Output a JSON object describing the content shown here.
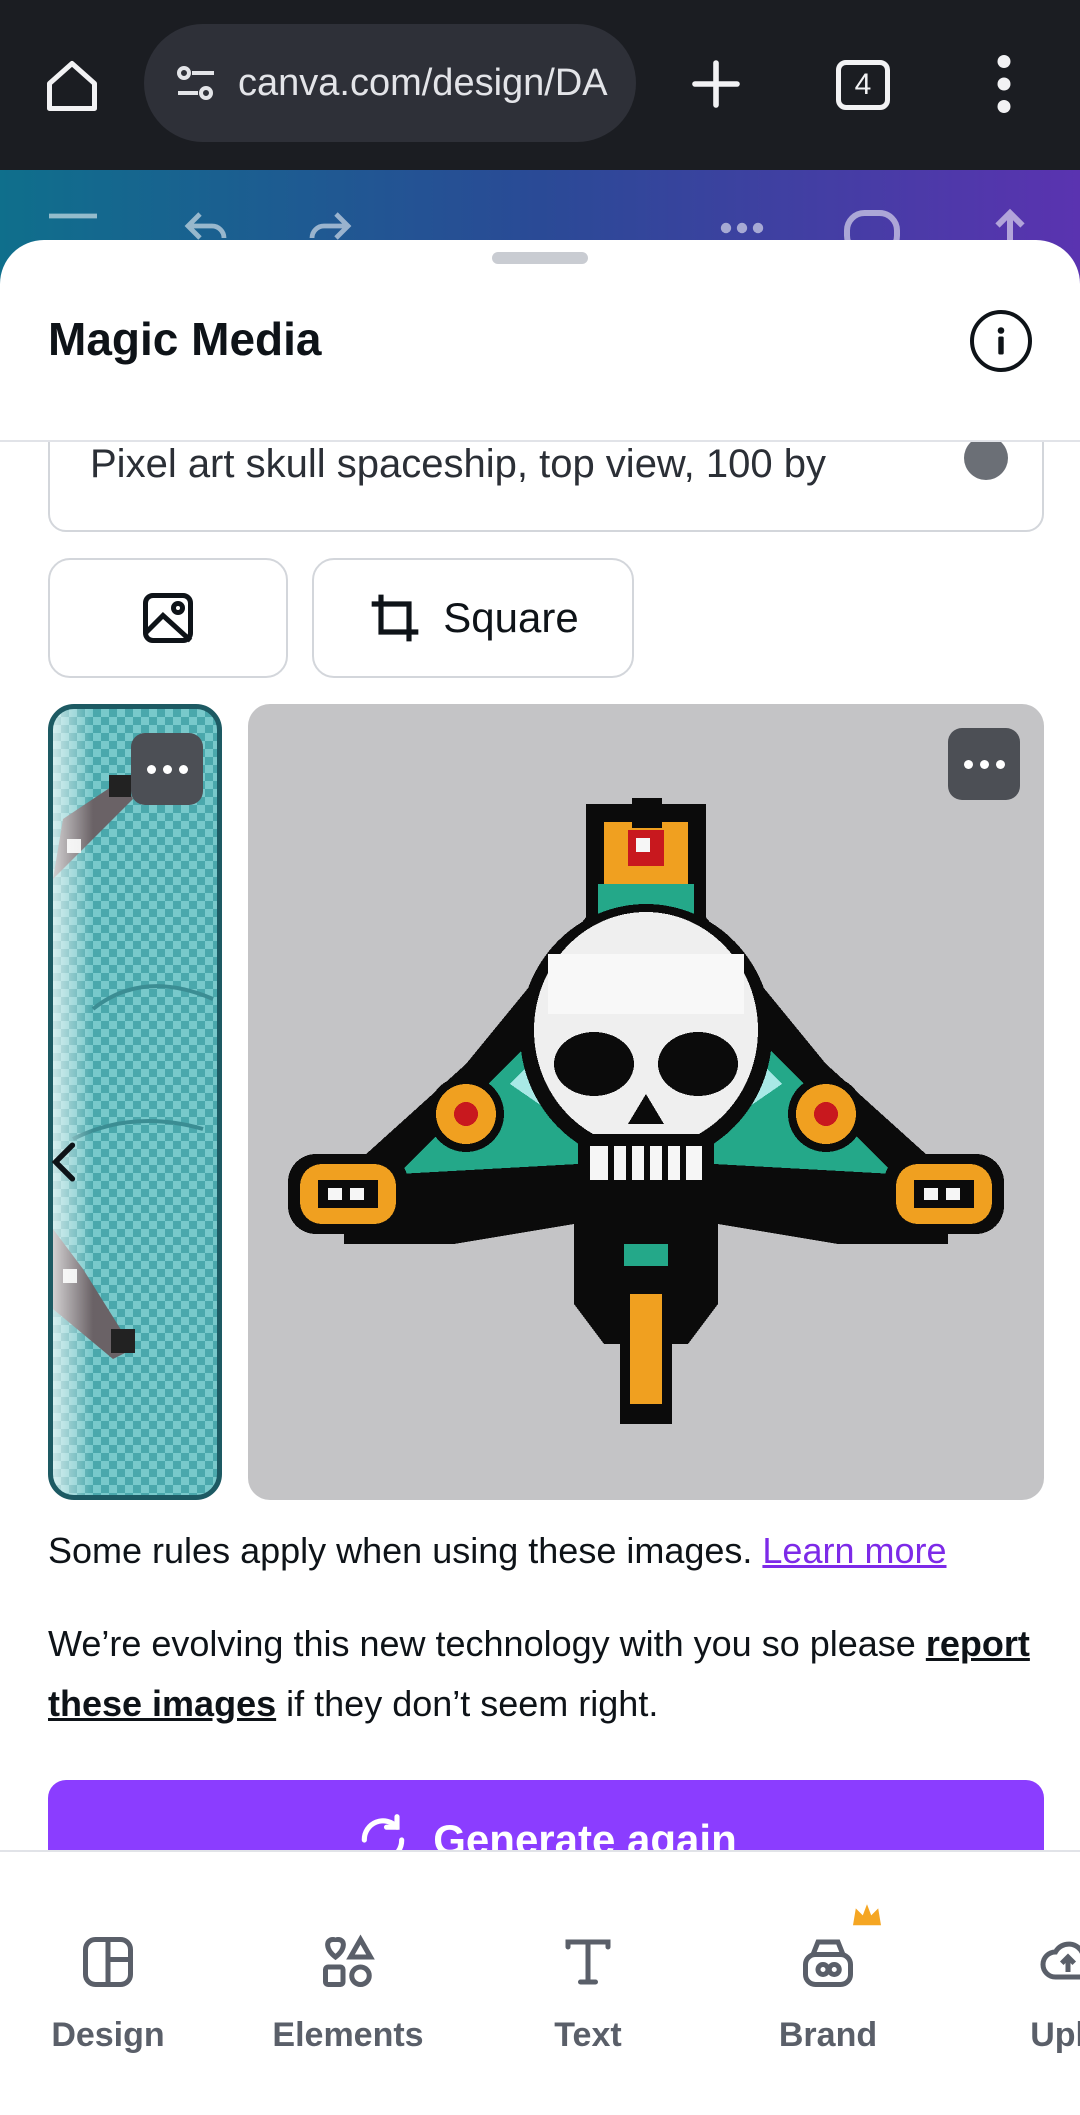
{
  "browser": {
    "url": "canva.com/design/DA",
    "tab_count": "4"
  },
  "sheet": {
    "title": "Magic Media"
  },
  "prompt": {
    "text": "Pixel art skull spaceship, top view, 100 by"
  },
  "options": {
    "aspect_ratio_label": "Square"
  },
  "notice": {
    "rules_text": "Some rules apply when using these images.",
    "learn_more": "Learn more",
    "evolve_prefix": "We’re evolving this new technology with you so please",
    "report_link": "report these images",
    "evolve_suffix": "if they don’t seem right."
  },
  "actions": {
    "generate_again": "Generate again"
  },
  "bottom_tabs": [
    {
      "label": "Design",
      "icon": "design-layout-icon"
    },
    {
      "label": "Elements",
      "icon": "shapes-icon"
    },
    {
      "label": "Text",
      "icon": "text-t-icon"
    },
    {
      "label": "Brand",
      "icon": "brand-icon"
    },
    {
      "label": "Uplo",
      "icon": "upload-cloud-icon"
    }
  ],
  "colors": {
    "accent": "#8b3dff",
    "link": "#7d2ae8",
    "crown": "#f5a623"
  }
}
